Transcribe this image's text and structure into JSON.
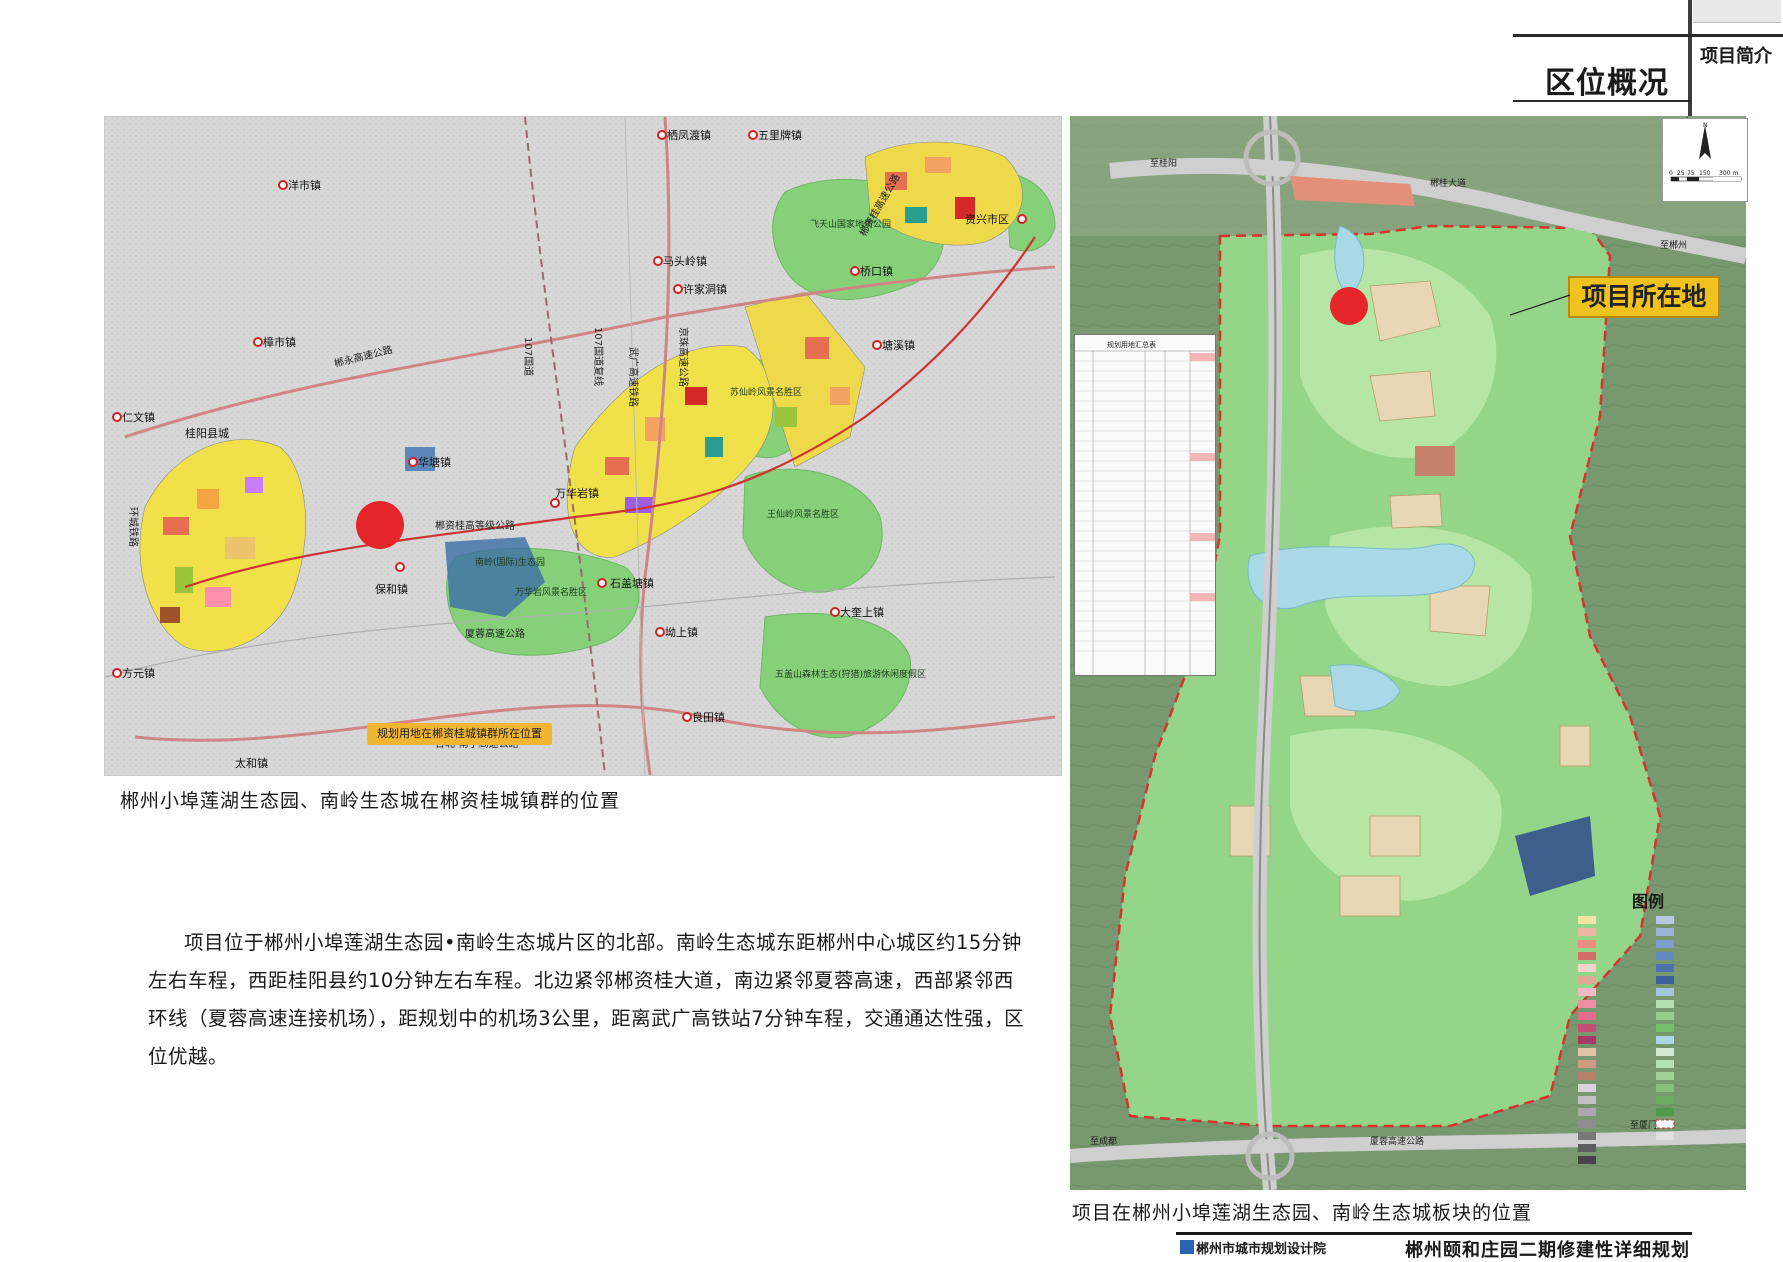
{
  "header": {
    "section_title": "区位概况",
    "section_tag": "项目简介"
  },
  "left_map": {
    "caption": "郴州小埠莲湖生态园、南岭生态城在郴资桂城镇群的位置",
    "callout_note": "规划用地在郴资桂城镇群所在位置",
    "place_labels": [
      "栖凤渡镇",
      "五里牌镇",
      "洋市镇",
      "马头岭镇",
      "许家洞镇",
      "桥口镇",
      "资兴市区",
      "樟市镇",
      "塘溪镇",
      "仁文镇",
      "桂阳县城",
      "华塘镇",
      "万华岩镇",
      "保和镇",
      "石盖塘镇",
      "坳上镇",
      "大奎上镇",
      "方元镇",
      "良田镇",
      "太和镇"
    ],
    "road_labels": [
      "107国道",
      "郴永高速公路",
      "京珠高速公路",
      "武广高速铁路",
      "107国道复线",
      "郴资桂高等级公路",
      "厦蓉高速公路",
      "环城铁路",
      "台北-南宁高速公路",
      "郴资桂高速公路"
    ],
    "area_labels": [
      "飞天山国家地质公园",
      "苏仙岭风景名胜区",
      "王仙岭风景名胜区",
      "南岭(国际)生态园",
      "万华岩风景名胜区",
      "五盖山森林生态(狩猎)旅游休闲度假区"
    ]
  },
  "right_map": {
    "caption": "项目在郴州小埠莲湖生态园、南岭生态城板块的位置",
    "project_label": "项目所在地",
    "road_labels": [
      "郴桂大道",
      "至桂阳",
      "至郴州",
      "厦蓉高速公路",
      "至成都",
      "至厦门"
    ],
    "legend_title": "图例",
    "table_title": "规划用地汇总表",
    "scale_labels": [
      "0",
      "25",
      "75",
      "150",
      "300 m"
    ],
    "north_label": "N"
  },
  "body_text": "项目位于郴州小埠莲湖生态园•南岭生态城片区的北部。南岭生态城东距郴州中心城区约15分钟左右车程，西距桂阳县约10分钟左右车程。北边紧邻郴资桂大道，南边紧邻夏蓉高速，西部紧邻西环线（夏蓉高速连接机场），距规划中的机场3公里，距离武广高铁站7分钟车程，交通通达性强，区位优越。",
  "footer": {
    "institute": "郴州市城市规划设计院",
    "project_title": "郴州颐和庄园二期修建性详细规划"
  },
  "colors": {
    "marker_red": "#e5262b",
    "label_yellow": "#f0c21d",
    "green_space": "#86d07a",
    "red_boundary": "#d8312e"
  }
}
